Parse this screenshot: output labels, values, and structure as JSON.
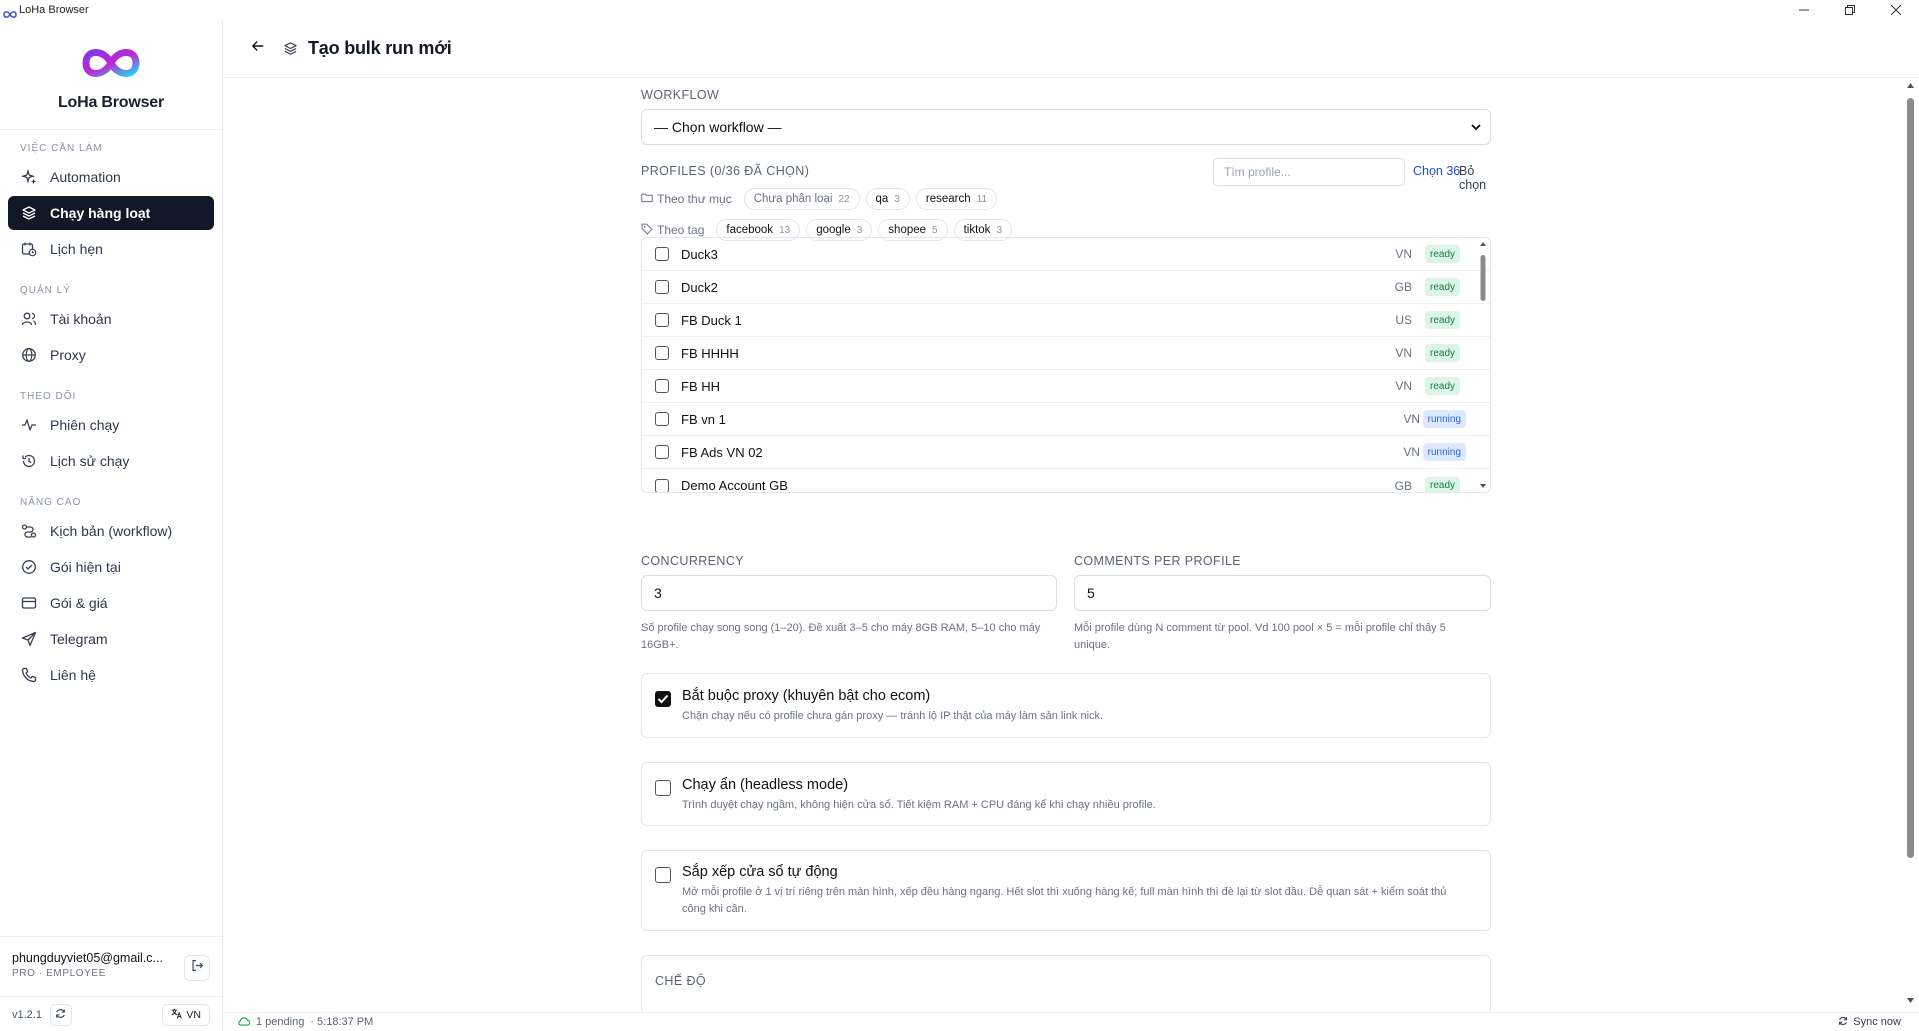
{
  "window": {
    "title": "LoHa Browser"
  },
  "brand": {
    "name": "LoHa Browser"
  },
  "sidebar": {
    "sections": [
      {
        "label": "VIỆC CẦN LÀM",
        "items": [
          {
            "label": "Automation",
            "icon": "sparkle-icon"
          },
          {
            "label": "Chạy hàng loạt",
            "icon": "layers-icon",
            "active": true
          },
          {
            "label": "Lịch hẹn",
            "icon": "calendar-clock-icon"
          }
        ]
      },
      {
        "label": "QUẢN LÝ",
        "items": [
          {
            "label": "Tài khoản",
            "icon": "users-icon"
          },
          {
            "label": "Proxy",
            "icon": "globe-icon"
          }
        ]
      },
      {
        "label": "THEO DÕI",
        "items": [
          {
            "label": "Phiên chạy",
            "icon": "activity-icon"
          },
          {
            "label": "Lịch sử chạy",
            "icon": "history-icon"
          }
        ]
      },
      {
        "label": "NÂNG CAO",
        "items": [
          {
            "label": "Kịch bản (workflow)",
            "icon": "workflow-icon"
          },
          {
            "label": "Gói hiện tại",
            "icon": "check-circle-icon"
          },
          {
            "label": "Gói & giá",
            "icon": "credit-card-icon"
          },
          {
            "label": "Telegram",
            "icon": "send-icon"
          },
          {
            "label": "Liên hệ",
            "icon": "phone-icon"
          }
        ]
      }
    ],
    "user": {
      "email": "phungduyviet05@gmail.c...",
      "role": "PRO · EMPLOYEE"
    },
    "version": "v1.2.1",
    "language": "VN"
  },
  "header": {
    "title": "Tạo bulk run mới"
  },
  "form": {
    "workflow_label": "WORKFLOW",
    "workflow_value": "— Chọn workflow —",
    "profiles_label": "PROFILES (0/36 ĐÃ CHỌN)",
    "profile_search_placeholder": "Tìm profile...",
    "select_all": "Chọn 36",
    "deselect": "Bỏ chọn",
    "folder_filter_label": "Theo thư mục",
    "folders": [
      {
        "name": "Chưa phân loại",
        "count": "22",
        "muted": true
      },
      {
        "name": "qa",
        "count": "3"
      },
      {
        "name": "research",
        "count": "11"
      }
    ],
    "tag_filter_label": "Theo tag",
    "tags": [
      {
        "name": "facebook",
        "count": "13"
      },
      {
        "name": "google",
        "count": "3"
      },
      {
        "name": "shopee",
        "count": "5"
      },
      {
        "name": "tiktok",
        "count": "3"
      }
    ],
    "profiles": [
      {
        "name": "Duck3",
        "country": "VN",
        "status": "ready"
      },
      {
        "name": "Duck2",
        "country": "GB",
        "status": "ready"
      },
      {
        "name": "FB Duck 1",
        "country": "US",
        "status": "ready"
      },
      {
        "name": "FB HHHH",
        "country": "VN",
        "status": "ready"
      },
      {
        "name": "FB HH",
        "country": "VN",
        "status": "ready"
      },
      {
        "name": "FB vn 1",
        "country": "VN",
        "status": "running"
      },
      {
        "name": "FB Ads VN 02",
        "country": "VN",
        "status": "running"
      },
      {
        "name": "Demo Account GB",
        "country": "GB",
        "status": "ready"
      }
    ],
    "concurrency": {
      "label": "CONCURRENCY",
      "value": "3",
      "hint": "Số profile chạy song song (1–20). Đề xuất 3–5 cho máy 8GB RAM, 5–10 cho máy 16GB+."
    },
    "comments": {
      "label": "COMMENTS PER PROFILE",
      "value": "5",
      "hint": "Mỗi profile dùng N comment từ pool. Vd 100 pool × 5 = mỗi profile chỉ thấy 5 unique."
    },
    "options": [
      {
        "title": "Bắt buộc proxy (khuyên bật cho ecom)",
        "desc": "Chặn chạy nếu có profile chưa gán proxy — tránh lộ IP thật của máy làm sản link nick.",
        "checked": true
      },
      {
        "title": "Chạy ẩn (headless mode)",
        "desc": "Trình duyệt chạy ngầm, không hiện cửa sổ. Tiết kiệm RAM + CPU đáng kể khi chạy nhiều profile.",
        "checked": false
      },
      {
        "title": "Sắp xếp cửa sổ tự động",
        "desc": "Mở mỗi profile ở 1 vị trí riêng trên màn hình, xếp đều hàng ngang. Hết slot thì xuống hàng kế; full màn hình thì đè lại từ slot đầu. Dễ quan sát + kiểm soát thủ công khi cần.",
        "checked": false
      }
    ],
    "mode_label": "CHẾ ĐỘ"
  },
  "statusbar": {
    "pending": "1 pending",
    "time": "· 5:18:37 PM",
    "sync": "Sync now"
  },
  "colors": {
    "active_nav": "#111827",
    "link": "#1d4ed8",
    "ready": "#15803d",
    "running": "#2563eb"
  }
}
